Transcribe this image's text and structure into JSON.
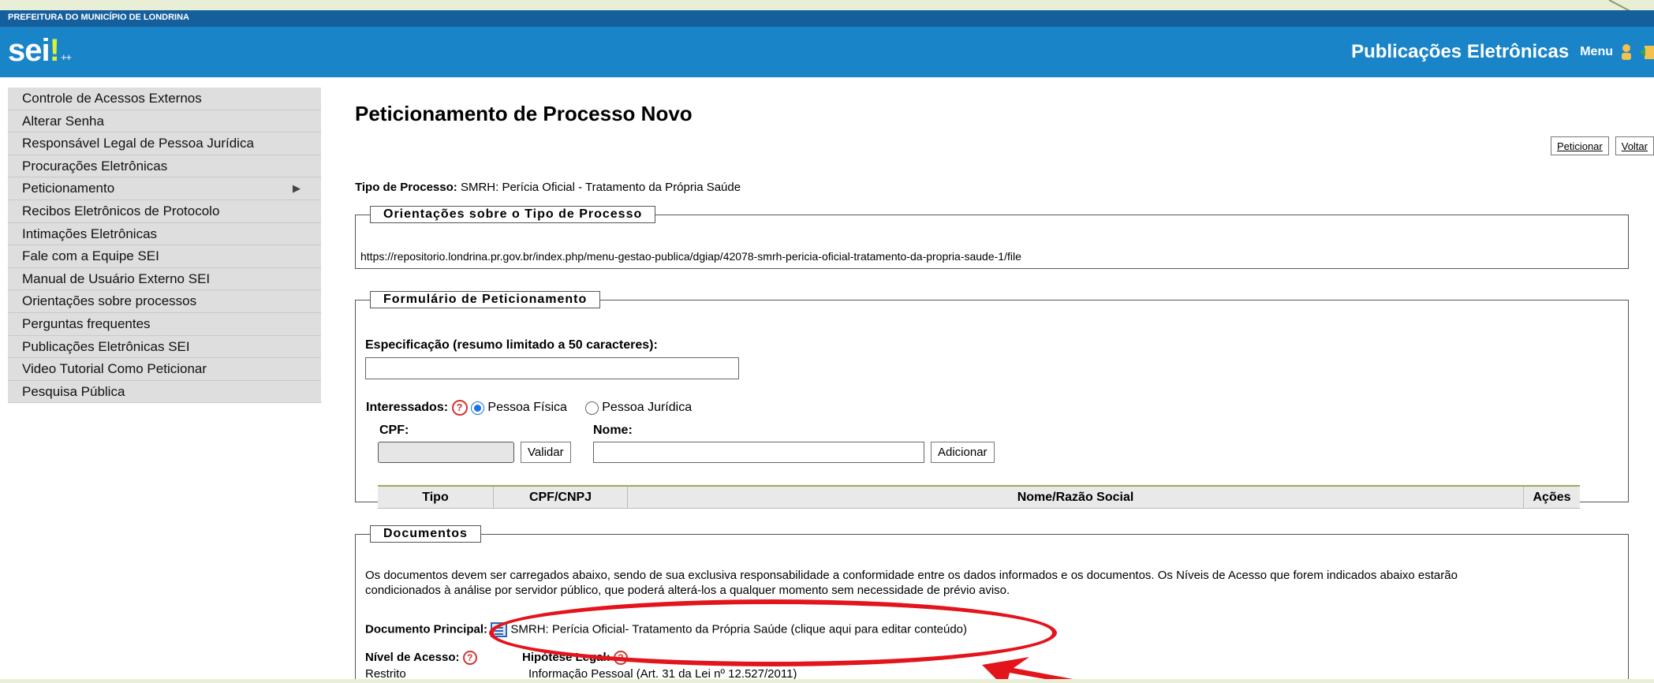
{
  "header": {
    "org_name": "PREFEITURA DO MUNICÍPIO DE LONDRINA",
    "logo_text": "sei",
    "logo_suffix": "++",
    "app_title": "Publicações Eletrônicas",
    "menu_label": "Menu",
    "icons": [
      "user-icon",
      "exit-icon"
    ]
  },
  "sidebar": {
    "items": [
      {
        "label": "Controle de Acessos Externos"
      },
      {
        "label": "Alterar Senha"
      },
      {
        "label": "Responsável Legal de Pessoa Jurídica"
      },
      {
        "label": "Procurações Eletrônicas"
      },
      {
        "label": "Peticionamento",
        "submenu": true
      },
      {
        "label": "Recibos Eletrônicos de Protocolo"
      },
      {
        "label": "Intimações Eletrônicas"
      },
      {
        "label": "Fale com a Equipe SEI"
      },
      {
        "label": "Manual de Usuário Externo SEI"
      },
      {
        "label": "Orientações sobre processos"
      },
      {
        "label": "Perguntas frequentes"
      },
      {
        "label": "Publicações Eletrônicas SEI"
      },
      {
        "label": "Video Tutorial Como Peticionar"
      },
      {
        "label": "Pesquisa Pública"
      }
    ]
  },
  "main": {
    "title": "Peticionamento de Processo Novo",
    "buttons": {
      "peticionar": "Peticionar",
      "voltar": "Voltar"
    },
    "tipo_label": "Tipo de Processo:",
    "tipo_value": "SMRH: Perícia Oficial - Tratamento da Própria Saúde",
    "orientacoes": {
      "legend": "Orientações sobre o Tipo de Processo",
      "url": "https://repositorio.londrina.pr.gov.br/index.php/menu-gestao-publica/dgiap/42078-smrh-pericia-oficial-tratamento-da-propria-saude-1/file"
    },
    "formulario": {
      "legend": "Formulário de Peticionamento",
      "especificacao_label": "Especificação (resumo limitado a 50 caracteres):",
      "especificacao_value": "",
      "interessados_label": "Interessados:",
      "radio_pf": "Pessoa Física",
      "radio_pj": "Pessoa Jurídica",
      "selected": "Pessoa Física",
      "cpf_label": "CPF:",
      "nome_label": "Nome:",
      "validar_button": "Validar",
      "adicionar_button": "Adicionar",
      "table_headers": [
        "Tipo",
        "CPF/CNPJ",
        "Nome/Razão Social",
        "Ações"
      ]
    },
    "documentos": {
      "legend": "Documentos",
      "info_line1": "Os documentos devem ser carregados abaixo, sendo de sua exclusiva responsabilidade a conformidade entre os dados informados e os documentos. Os Níveis de Acesso que forem indicados abaixo estarão",
      "info_line2": "condicionados à análise por servidor público, que poderá alterá-los a qualquer momento sem necessidade de prévio aviso.",
      "principal_label": "Documento Principal:",
      "principal_name": "SMRH: Perícia Oficial- Tratamento da Própria Saúde",
      "principal_edit_link": "(clique aqui para editar conteúdo)",
      "nivel_label": "Nível de Acesso:",
      "nivel_value": "Restrito",
      "hipotese_label": "Hipótese Legal:",
      "hipotese_value": "Informação Pessoal (Art. 31 da Lei nº 12.527/2011)"
    }
  },
  "colors": {
    "org_bar": "#155f9c",
    "brand_bar": "#1a84c8",
    "annotation_red": "#e3141b",
    "slide_bg": "#e8efd6"
  }
}
